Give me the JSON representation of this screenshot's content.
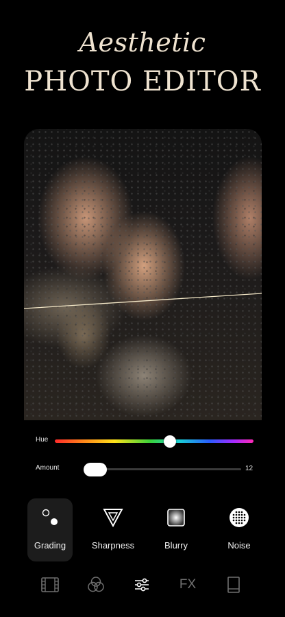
{
  "headline": {
    "line1": "Aesthetic",
    "line2": "PHOTO EDITOR"
  },
  "photo": {
    "description_icon": "photo-preview"
  },
  "adjustments": {
    "hue": {
      "label": "Hue",
      "level_fraction": 0.58
    },
    "amount": {
      "label": "Amount",
      "value": "12",
      "level_fraction": 0.06
    }
  },
  "tools": [
    {
      "name": "Grading",
      "icon": "grading-icon",
      "active": true
    },
    {
      "name": "Sharpness",
      "icon": "sharpness-icon",
      "active": false
    },
    {
      "name": "Blurry",
      "icon": "blurry-icon",
      "active": false
    },
    {
      "name": "Noise",
      "icon": "noise-icon",
      "active": false
    }
  ],
  "tabbar": {
    "items": [
      {
        "icon": "film-icon"
      },
      {
        "icon": "color-circles-icon"
      },
      {
        "icon": "sliders-icon",
        "active": true
      },
      {
        "icon": "fx-icon",
        "label": "FX"
      },
      {
        "icon": "frame-icon"
      }
    ]
  },
  "colors": {
    "headline": "#efe3d0",
    "background": "#000000",
    "inactive_icon": "#707070"
  }
}
